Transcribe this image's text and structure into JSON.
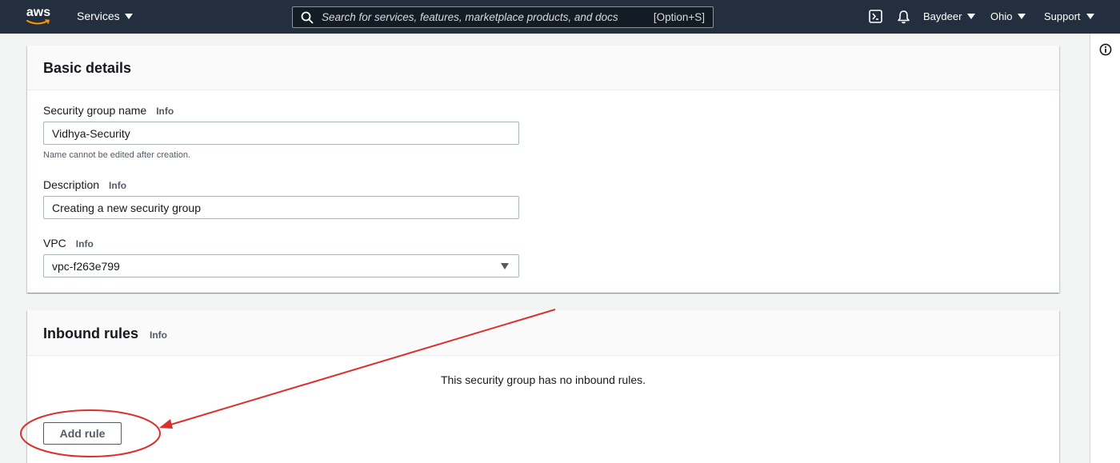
{
  "topnav": {
    "logo_text": "aws",
    "services_label": "Services",
    "search": {
      "placeholder": "Search for services, features, marketplace products, and docs",
      "shortcut": "[Option+S]"
    },
    "account_label": "Baydeer",
    "region_label": "Ohio",
    "support_label": "Support",
    "icons": [
      "cloudshell-icon",
      "bell-icon"
    ]
  },
  "basic_details": {
    "title": "Basic details",
    "name": {
      "label": "Security group name",
      "info": "Info",
      "value": "Vidhya-Security",
      "hint": "Name cannot be edited after creation."
    },
    "description": {
      "label": "Description",
      "info": "Info",
      "value": "Creating a new security group"
    },
    "vpc": {
      "label": "VPC",
      "info": "Info",
      "value": "vpc-f263e799"
    }
  },
  "inbound_rules": {
    "title": "Inbound rules",
    "info": "Info",
    "empty_message": "This security group has no inbound rules.",
    "add_rule_label": "Add rule"
  },
  "colors": {
    "nav_bg": "#232f3e",
    "page_bg": "#f2f3f3",
    "annotation": "#d9322e"
  }
}
